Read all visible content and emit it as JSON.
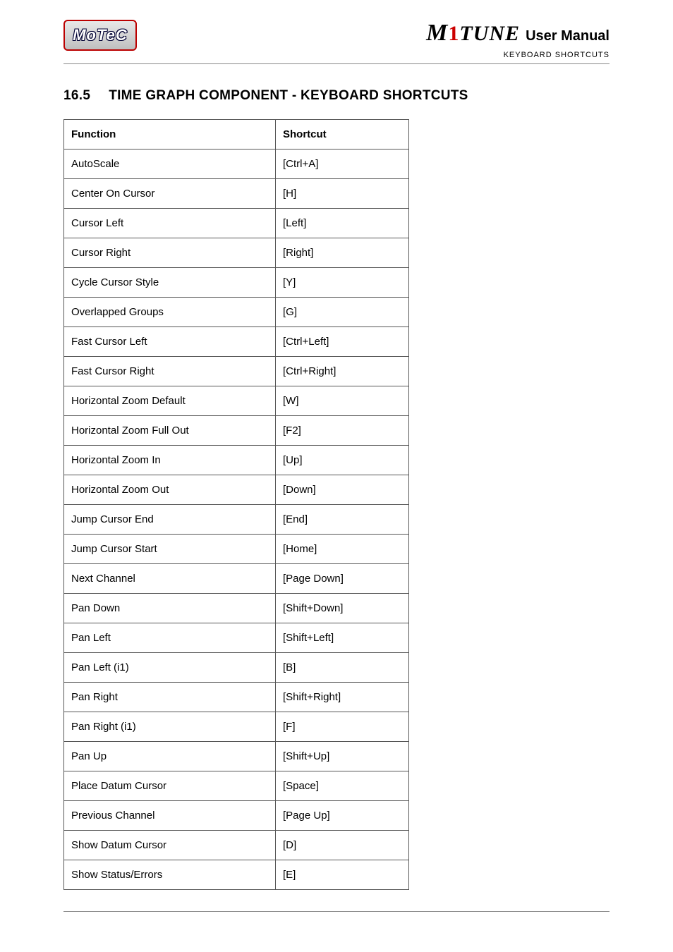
{
  "header": {
    "logo_text": "MoTeC",
    "brand_prefix_m": "M",
    "brand_one": "1",
    "brand_tune": "TUNE",
    "user_manual": "User Manual",
    "subhead": "KEYBOARD SHORTCUTS"
  },
  "section": {
    "number": "16.5",
    "title": "TIME GRAPH COMPONENT - KEYBOARD SHORTCUTS"
  },
  "table": {
    "head_function": "Function",
    "head_shortcut": "Shortcut",
    "rows": [
      {
        "fn": "AutoScale",
        "sc": "[Ctrl+A]"
      },
      {
        "fn": "Center On Cursor",
        "sc": "[H]"
      },
      {
        "fn": "Cursor Left",
        "sc": "[Left]"
      },
      {
        "fn": "Cursor Right",
        "sc": "[Right]"
      },
      {
        "fn": "Cycle Cursor Style",
        "sc": "[Y]"
      },
      {
        "fn": "Overlapped Groups",
        "sc": "[G]"
      },
      {
        "fn": "Fast Cursor Left",
        "sc": "[Ctrl+Left]"
      },
      {
        "fn": "Fast Cursor Right",
        "sc": "[Ctrl+Right]"
      },
      {
        "fn": "Horizontal Zoom Default",
        "sc": "[W]"
      },
      {
        "fn": "Horizontal Zoom Full Out",
        "sc": "[F2]"
      },
      {
        "fn": "Horizontal Zoom In",
        "sc": "[Up]"
      },
      {
        "fn": "Horizontal Zoom Out",
        "sc": "[Down]"
      },
      {
        "fn": "Jump Cursor End",
        "sc": "[End]"
      },
      {
        "fn": "Jump Cursor Start",
        "sc": "[Home]"
      },
      {
        "fn": "Next Channel",
        "sc": "[Page Down]"
      },
      {
        "fn": "Pan Down",
        "sc": "[Shift+Down]"
      },
      {
        "fn": "Pan Left",
        "sc": "[Shift+Left]"
      },
      {
        "fn": "Pan Left (i1)",
        "sc": "[B]"
      },
      {
        "fn": "Pan Right",
        "sc": "[Shift+Right]"
      },
      {
        "fn": "Pan Right (i1)",
        "sc": "[F]"
      },
      {
        "fn": "Pan Up",
        "sc": "[Shift+Up]"
      },
      {
        "fn": "Place Datum Cursor",
        "sc": "[Space]"
      },
      {
        "fn": "Previous Channel",
        "sc": "[Page Up]"
      },
      {
        "fn": "Show Datum Cursor",
        "sc": "[D]"
      },
      {
        "fn": "Show Status/Errors",
        "sc": "[E]"
      }
    ]
  }
}
